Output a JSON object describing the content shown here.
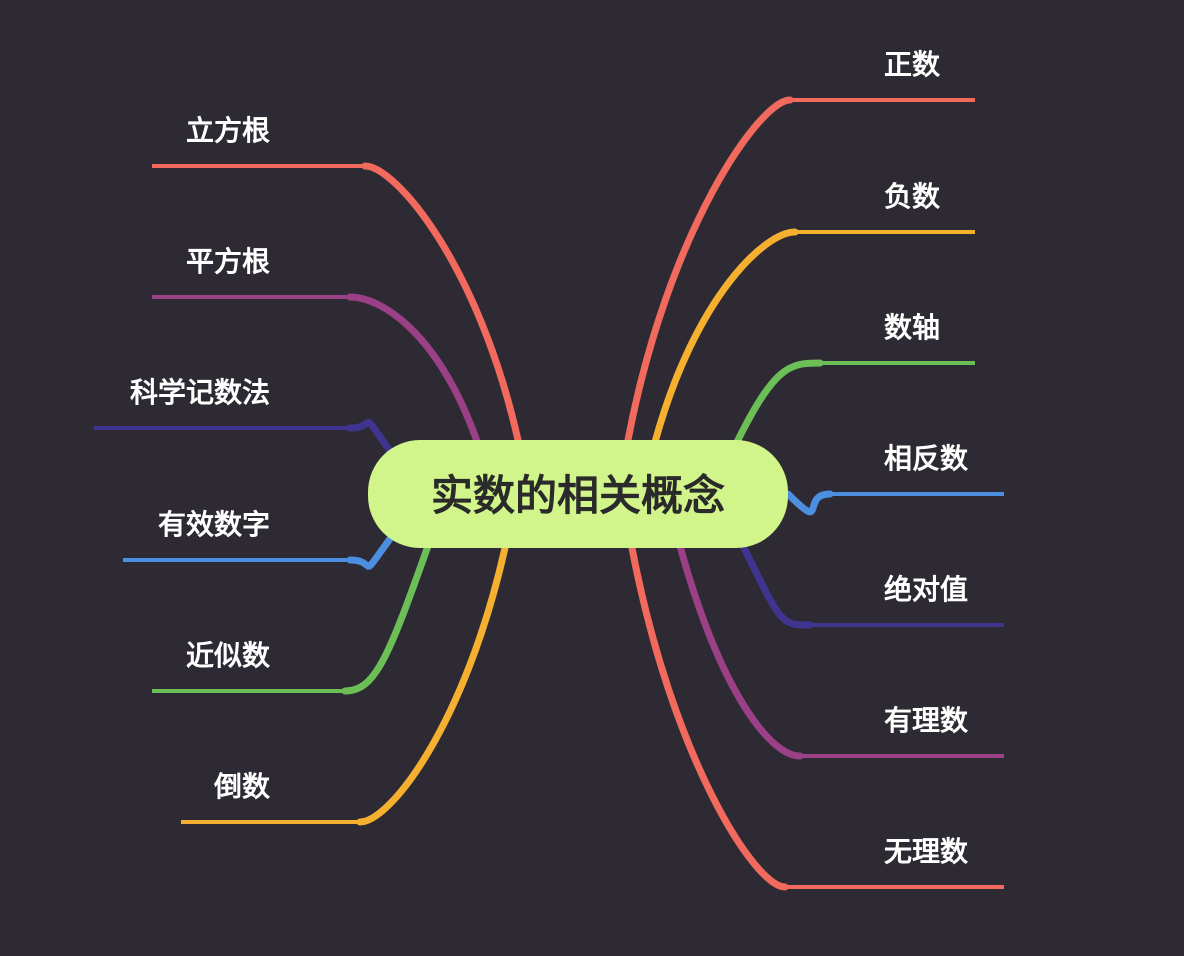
{
  "center": {
    "title": "实数的相关概念",
    "color": "#d1f58a"
  },
  "left_branches": [
    {
      "label": "立方根",
      "color": "#f26a5d"
    },
    {
      "label": "平方根",
      "color": "#9b3f86"
    },
    {
      "label": "科学记数法",
      "color": "#3f3590"
    },
    {
      "label": "有效数字",
      "color": "#4c8fe0"
    },
    {
      "label": "近似数",
      "color": "#6cbf56"
    },
    {
      "label": "倒数",
      "color": "#f6b02f"
    }
  ],
  "right_branches": [
    {
      "label": "正数",
      "color": "#f26a5d"
    },
    {
      "label": "负数",
      "color": "#f6b02f"
    },
    {
      "label": "数轴",
      "color": "#6cbf56"
    },
    {
      "label": "相反数",
      "color": "#4c8fe0"
    },
    {
      "label": "绝对值",
      "color": "#3f3590"
    },
    {
      "label": "有理数",
      "color": "#9b3f86"
    },
    {
      "label": "无理数",
      "color": "#f26a5d"
    }
  ]
}
